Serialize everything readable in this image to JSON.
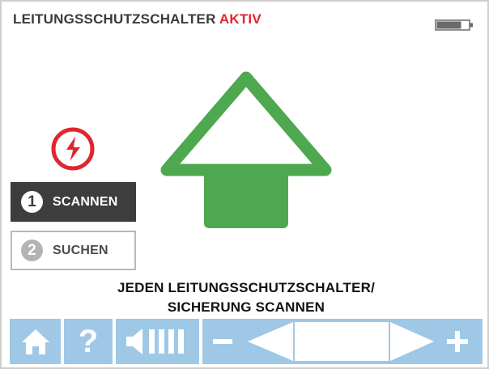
{
  "header": {
    "title": "LEITUNGSSCHUTZSCHALTER",
    "status": "AKTIV",
    "status_color": "#e0262e",
    "battery_icon": "battery-icon"
  },
  "breaker_icon": "lightning-circle-icon",
  "modes": [
    {
      "number": "1",
      "label": "SCANNEN",
      "selected": true
    },
    {
      "number": "2",
      "label": "SUCHEN",
      "selected": false
    }
  ],
  "arrow": {
    "icon": "up-arrow-icon",
    "color": "#4ea84f"
  },
  "instruction": {
    "line1": "JEDEN LEITUNGSSCHUTZSCHALTER/",
    "line2": "SICHERUNG SCANNEN"
  },
  "toolbar": {
    "color": "#9fc8e6",
    "home_icon": "home-icon",
    "help_label": "?",
    "volume_icon": "volume-icon",
    "minus_icon": "minus-icon",
    "left_icon": "left-arrow-icon",
    "right_icon": "right-arrow-icon",
    "plus_icon": "plus-icon"
  }
}
